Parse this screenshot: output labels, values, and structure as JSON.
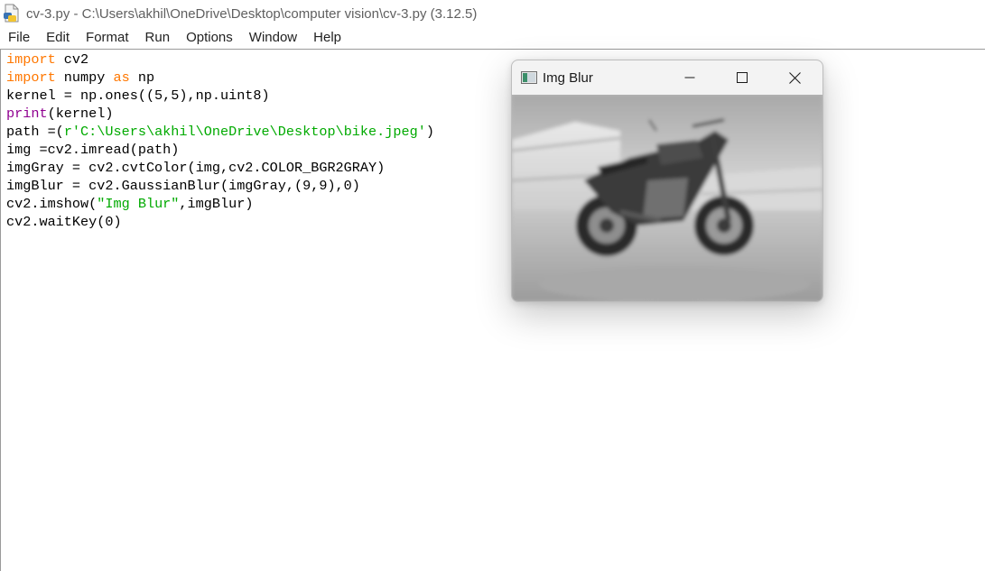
{
  "window": {
    "title": "cv-3.py - C:\\Users\\akhil\\OneDrive\\Desktop\\computer vision\\cv-3.py (3.12.5)",
    "icon": "python-file-icon"
  },
  "menu": {
    "items": [
      "File",
      "Edit",
      "Format",
      "Run",
      "Options",
      "Window",
      "Help"
    ]
  },
  "editor": {
    "lines": [
      [
        {
          "t": "import",
          "c": "kw"
        },
        {
          "t": " cv2",
          "c": ""
        }
      ],
      [
        {
          "t": "import",
          "c": "kw"
        },
        {
          "t": " numpy ",
          "c": ""
        },
        {
          "t": "as",
          "c": "kw"
        },
        {
          "t": " np",
          "c": ""
        }
      ],
      [
        {
          "t": "kernel = np.ones((5,5),np.uint8)",
          "c": ""
        }
      ],
      [
        {
          "t": "print",
          "c": "bi"
        },
        {
          "t": "(kernel)",
          "c": ""
        }
      ],
      [
        {
          "t": "path =(",
          "c": ""
        },
        {
          "t": "r'C:\\Users\\akhil\\OneDrive\\Desktop\\bike.jpeg'",
          "c": "st"
        },
        {
          "t": ")",
          "c": ""
        }
      ],
      [
        {
          "t": "img =cv2.imread(path)",
          "c": ""
        }
      ],
      [
        {
          "t": "imgGray = cv2.cvtColor(img,cv2.COLOR_BGR2GRAY)",
          "c": ""
        }
      ],
      [
        {
          "t": "imgBlur = cv2.GaussianBlur(imgGray,(9,9),0)",
          "c": ""
        }
      ],
      [
        {
          "t": "cv2.imshow(",
          "c": ""
        },
        {
          "t": "\"Img Blur\"",
          "c": "st"
        },
        {
          "t": ",imgBlur)",
          "c": ""
        }
      ],
      [
        {
          "t": "cv2.waitKey(0)",
          "c": ""
        }
      ]
    ],
    "colors": {
      "keyword": "#ff7700",
      "builtin": "#900090",
      "string": "#00aa00",
      "text": "#000000"
    }
  },
  "cv_window": {
    "title": "Img Blur",
    "icon": "opencv-window-icon",
    "minimize_icon": "minimize-icon",
    "maximize_icon": "maximize-icon",
    "close_icon": "close-icon",
    "image": "blurred-grayscale-motorcycle"
  }
}
